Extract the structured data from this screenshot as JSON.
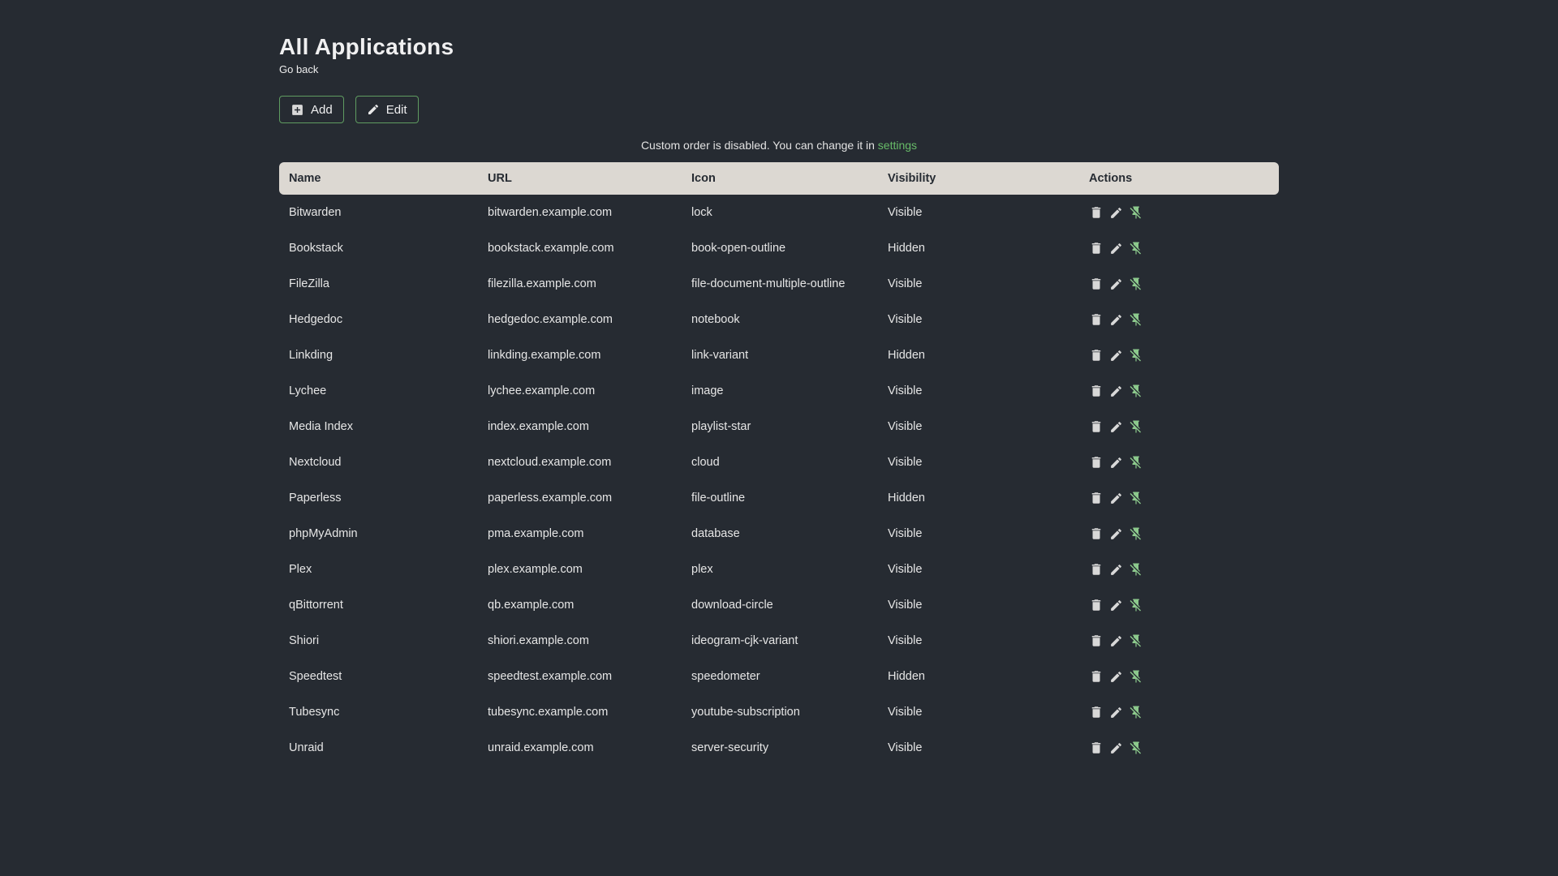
{
  "page": {
    "title": "All Applications",
    "back_link": "Go back",
    "info_text": "Custom order is disabled. You can change it in ",
    "info_link_label": "settings"
  },
  "toolbar": {
    "add_label": "Add",
    "edit_label": "Edit"
  },
  "table": {
    "columns": [
      "Name",
      "URL",
      "Icon",
      "Visibility",
      "Actions"
    ],
    "rows": [
      {
        "name": "Bitwarden",
        "url": "bitwarden.example.com",
        "icon": "lock",
        "visibility": "Visible"
      },
      {
        "name": "Bookstack",
        "url": "bookstack.example.com",
        "icon": "book-open-outline",
        "visibility": "Hidden"
      },
      {
        "name": "FileZilla",
        "url": "filezilla.example.com",
        "icon": "file-document-multiple-outline",
        "visibility": "Visible"
      },
      {
        "name": "Hedgedoc",
        "url": "hedgedoc.example.com",
        "icon": "notebook",
        "visibility": "Visible"
      },
      {
        "name": "Linkding",
        "url": "linkding.example.com",
        "icon": "link-variant",
        "visibility": "Hidden"
      },
      {
        "name": "Lychee",
        "url": "lychee.example.com",
        "icon": "image",
        "visibility": "Visible"
      },
      {
        "name": "Media Index",
        "url": "index.example.com",
        "icon": "playlist-star",
        "visibility": "Visible"
      },
      {
        "name": "Nextcloud",
        "url": "nextcloud.example.com",
        "icon": "cloud",
        "visibility": "Visible"
      },
      {
        "name": "Paperless",
        "url": "paperless.example.com",
        "icon": "file-outline",
        "visibility": "Hidden"
      },
      {
        "name": "phpMyAdmin",
        "url": "pma.example.com",
        "icon": "database",
        "visibility": "Visible"
      },
      {
        "name": "Plex",
        "url": "plex.example.com",
        "icon": "plex",
        "visibility": "Visible"
      },
      {
        "name": "qBittorrent",
        "url": "qb.example.com",
        "icon": "download-circle",
        "visibility": "Visible"
      },
      {
        "name": "Shiori",
        "url": "shiori.example.com",
        "icon": "ideogram-cjk-variant",
        "visibility": "Visible"
      },
      {
        "name": "Speedtest",
        "url": "speedtest.example.com",
        "icon": "speedometer",
        "visibility": "Hidden"
      },
      {
        "name": "Tubesync",
        "url": "tubesync.example.com",
        "icon": "youtube-subscription",
        "visibility": "Visible"
      },
      {
        "name": "Unraid",
        "url": "unraid.example.com",
        "icon": "server-security",
        "visibility": "Visible"
      }
    ],
    "action_icons": [
      "trash-icon",
      "pencil-icon",
      "pin-off-icon"
    ]
  },
  "colors": {
    "background": "#262B32",
    "accent_green": "#67BB68",
    "button_border_green": "#5F9C61",
    "pin_icon_green": "#8CC98C",
    "header_bg": "#DCD8D2",
    "text_light": "#E6E6E6"
  }
}
